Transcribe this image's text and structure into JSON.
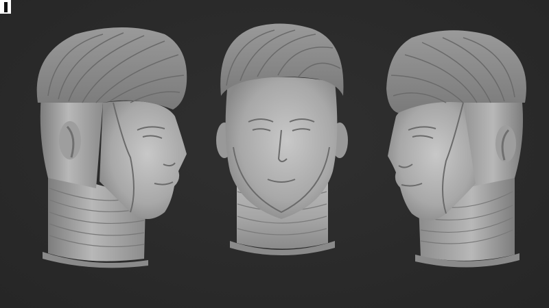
{
  "scene": {
    "background_color": "#2b2b2b",
    "clay_color": "#a9a9a9",
    "clay_shadow_color": "#6e6e6e",
    "clay_highlight_color": "#d2d2d2"
  },
  "views": [
    {
      "id": "left-three-quarter",
      "facing": "right"
    },
    {
      "id": "front",
      "facing": "front"
    },
    {
      "id": "right-three-quarter",
      "facing": "left"
    }
  ]
}
